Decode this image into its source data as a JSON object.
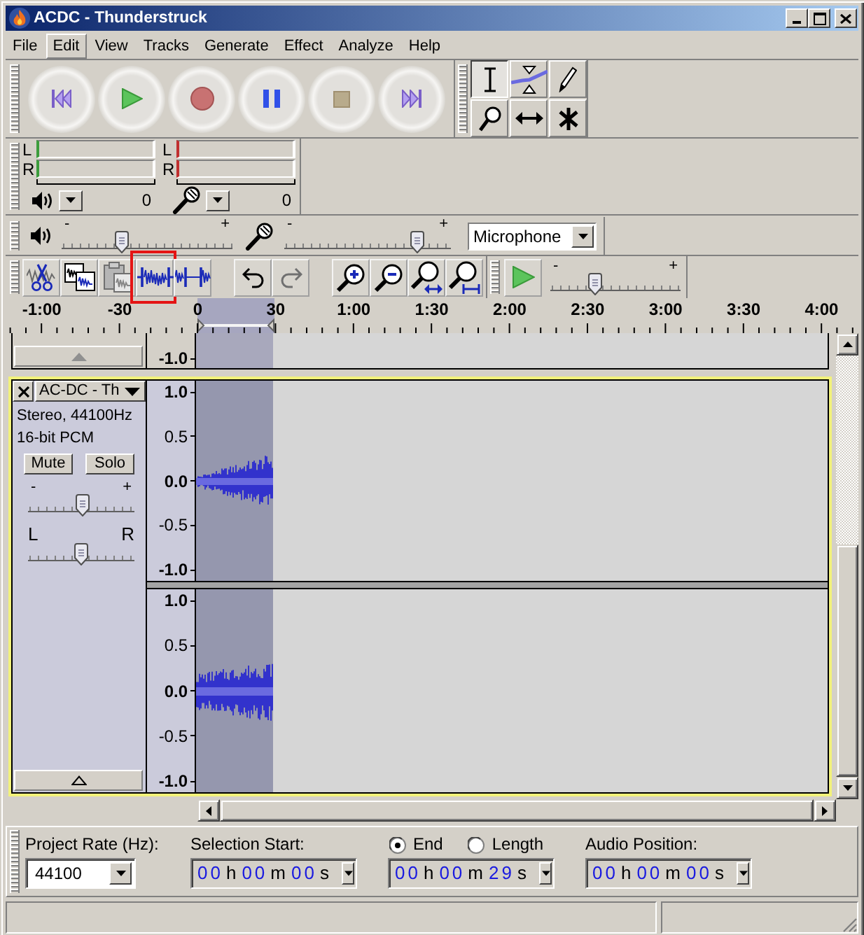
{
  "window": {
    "title": "ACDC - Thunderstruck"
  },
  "menu": [
    {
      "label": "File",
      "highlighted": false
    },
    {
      "label": "Edit",
      "highlighted": true
    },
    {
      "label": "View",
      "highlighted": false
    },
    {
      "label": "Tracks",
      "highlighted": false
    },
    {
      "label": "Generate",
      "highlighted": false
    },
    {
      "label": "Effect",
      "highlighted": false
    },
    {
      "label": "Analyze",
      "highlighted": false
    },
    {
      "label": "Help",
      "highlighted": false
    }
  ],
  "transport": [
    {
      "kind": "skip-start"
    },
    {
      "kind": "play"
    },
    {
      "kind": "record"
    },
    {
      "kind": "pause"
    },
    {
      "kind": "stop"
    },
    {
      "kind": "skip-end"
    }
  ],
  "tools": [
    {
      "kind": "select",
      "selected": true
    },
    {
      "kind": "envelope",
      "selected": false
    },
    {
      "kind": "draw",
      "selected": false
    },
    {
      "kind": "zoom",
      "selected": false
    },
    {
      "kind": "time-shift",
      "selected": false
    },
    {
      "kind": "multi",
      "selected": false
    }
  ],
  "meters": [
    {
      "kind": "playback",
      "channels": [
        "L",
        "R"
      ],
      "reading": "0"
    },
    {
      "kind": "recording",
      "channels": [
        "L",
        "R"
      ],
      "reading": "0"
    }
  ],
  "mixer": {
    "output": {
      "min_label": "-",
      "max_label": "+",
      "level": 0.34
    },
    "input": {
      "min_label": "-",
      "max_label": "+",
      "level": 0.83
    },
    "input_source": "Microphone"
  },
  "edit_toolbar": [
    {
      "kind": "cut",
      "disabled": false,
      "annotated": false
    },
    {
      "kind": "copy",
      "disabled": false,
      "annotated": false
    },
    {
      "kind": "paste",
      "disabled": true,
      "annotated": false
    },
    {
      "kind": "trim",
      "disabled": false,
      "annotated": true
    },
    {
      "kind": "silence",
      "disabled": false,
      "annotated": false
    },
    {
      "kind": "undo",
      "disabled": false,
      "annotated": false
    },
    {
      "kind": "redo",
      "disabled": true,
      "annotated": false
    },
    {
      "kind": "zoom-in",
      "disabled": false,
      "annotated": false
    },
    {
      "kind": "zoom-out",
      "disabled": false,
      "annotated": false
    },
    {
      "kind": "fit-selection",
      "disabled": false,
      "annotated": false
    },
    {
      "kind": "fit-project",
      "disabled": false,
      "annotated": false
    }
  ],
  "play_at_speed": {
    "min_label": "-",
    "max_label": "+",
    "level": 0.32
  },
  "ruler": {
    "labels": [
      "-1:00",
      "-30",
      "0",
      "30",
      "1:00",
      "1:30",
      "2:00",
      "2:30",
      "3:00",
      "3:30",
      "4:00"
    ]
  },
  "tracks": [
    {
      "kind": "clipped",
      "selected": false,
      "focused": false,
      "channels": [
        {
          "scale": [
            {
              "label": "-1.0",
              "major": true
            }
          ]
        }
      ]
    },
    {
      "kind": "audio",
      "selected": true,
      "focused": true,
      "name": "AC-DC - Th",
      "info": [
        "Stereo, 44100Hz",
        "16-bit PCM"
      ],
      "buttons": [
        {
          "label": "Mute",
          "on": false
        },
        {
          "label": "Solo",
          "on": false
        }
      ],
      "gain": {
        "min_label": "-",
        "max_label": "+",
        "level": 0.51
      },
      "pan": {
        "min_label": "L",
        "max_label": "R",
        "level": 0.5
      },
      "channels": [
        {
          "scale": [
            {
              "label": "1.0",
              "major": true
            },
            {
              "label": "0.5",
              "major": false
            },
            {
              "label": "0.0",
              "major": true
            },
            {
              "label": "-0.5",
              "major": false
            },
            {
              "label": "-1.0",
              "major": true
            }
          ]
        },
        {
          "scale": [
            {
              "label": "1.0",
              "major": true
            },
            {
              "label": "0.5",
              "major": false
            },
            {
              "label": "0.0",
              "major": true
            },
            {
              "label": "-0.5",
              "major": false
            },
            {
              "label": "-1.0",
              "major": true
            }
          ]
        }
      ]
    }
  ],
  "selection_bar": {
    "project_rate": {
      "label": "Project Rate (Hz):",
      "value": "44100"
    },
    "selection_start": {
      "label": "Selection Start:",
      "parts": [
        {
          "digits": "00",
          "unit": "h"
        },
        {
          "digits": "00",
          "unit": "m"
        },
        {
          "digits": "00",
          "unit": "s"
        }
      ]
    },
    "end_mode": [
      {
        "label": "End",
        "selected": true
      },
      {
        "label": "Length",
        "selected": false
      }
    ],
    "selection_end": {
      "parts": [
        {
          "digits": "00",
          "unit": "h"
        },
        {
          "digits": "00",
          "unit": "m"
        },
        {
          "digits": "29",
          "unit": "s"
        }
      ]
    },
    "audio_position": {
      "label": "Audio Position:",
      "parts": [
        {
          "digits": "00",
          "unit": "h"
        },
        {
          "digits": "00",
          "unit": "m"
        },
        {
          "digits": "00",
          "unit": "s"
        }
      ]
    }
  }
}
